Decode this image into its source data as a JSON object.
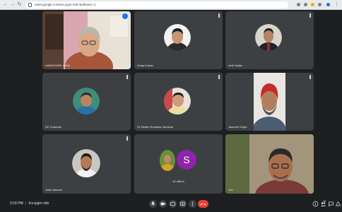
{
  "browser": {
    "url": "meet.google.com/tcs-pyjm-cbb?authuser=1"
  },
  "tiles": [
    {
      "name": "HANDICARE INDIA"
    },
    {
      "name": "Vinay Kumar"
    },
    {
      "name": "Amit Yadav"
    },
    {
      "name": "DK Chauhan"
    },
    {
      "name": "Dr Shaikh Shahbaz Zeeshan"
    },
    {
      "name": "Jasmeet Singh"
    },
    {
      "name": "Jobin Manuel"
    },
    {
      "name": "16 others",
      "avatar_letter": "S"
    },
    {
      "name": "You"
    }
  ],
  "meeting": {
    "time": "3:16 PM",
    "code": "tcs-pyjm-cbb",
    "participant_count": "46"
  },
  "colors": {
    "stage": "#1e1f21",
    "tile": "#3c4043",
    "end_call": "#ea4335",
    "purple_avatar": "#8e24aa",
    "speaking": "#1a73e8"
  },
  "icons": {
    "controls": [
      "microphone-icon",
      "camera-icon",
      "captions-icon",
      "present-icon",
      "more-icon",
      "end-call-icon"
    ],
    "right": [
      "info-icon",
      "people-icon",
      "chat-icon",
      "activities-icon"
    ]
  }
}
